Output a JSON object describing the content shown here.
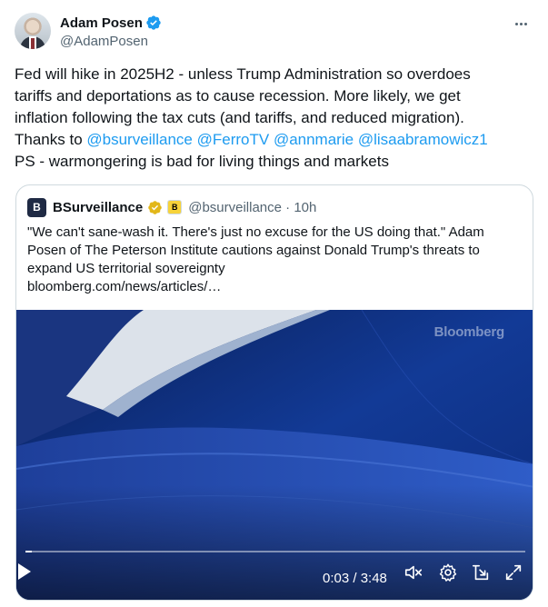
{
  "author": {
    "display_name": "Adam Posen",
    "handle": "@AdamPosen"
  },
  "tweet": {
    "lines": [
      [
        {
          "t": "Fed will hike in 2025H2 - unless Trump Administration so overdoes",
          "m": false
        }
      ],
      [
        {
          "t": "tariffs and deportations as to cause recession. More likely, we get",
          "m": false
        }
      ],
      [
        {
          "t": "inflation following the tax cuts (and tariffs, and reduced migration).",
          "m": false
        }
      ],
      [
        {
          "t": "Thanks to ",
          "m": false
        },
        {
          "t": "@bsurveillance",
          "m": true
        },
        {
          "t": " ",
          "m": false
        },
        {
          "t": "@FerroTV",
          "m": true
        },
        {
          "t": " ",
          "m": false
        },
        {
          "t": "@annmarie",
          "m": true
        },
        {
          "t": " ",
          "m": false
        },
        {
          "t": "@lisaabramowicz1",
          "m": true
        }
      ],
      [
        {
          "t": "PS - warmongering is bad for living things and markets",
          "m": false
        }
      ]
    ]
  },
  "quote": {
    "avatar_letter": "B",
    "name": "BSurveillance",
    "affiliate_letter": "B",
    "handle_time": "@bsurveillance · 10h",
    "lines": [
      "\"We can't sane-wash it. There's just no excuse for the US doing that.\" Adam",
      "Posen of The Peterson Institute cautions against Donald Trump's threats to",
      "expand US territorial sovereignty",
      "bloomberg.com/news/articles/…"
    ]
  },
  "video": {
    "watermark": "Bloomberg",
    "time": "0:03 / 3:48",
    "progress": 0.013
  },
  "colors": {
    "accent": "#1d9bf0",
    "verified_blue": "#1d9bf0",
    "gold_badge": "#e2b719",
    "video_bg": "#0b2a6e"
  },
  "icons": [
    "verified-icon",
    "more-icon",
    "gold-verified-icon",
    "play-icon",
    "mute-icon",
    "settings-icon",
    "exit-fullscreen-icon",
    "fullscreen-icon"
  ]
}
